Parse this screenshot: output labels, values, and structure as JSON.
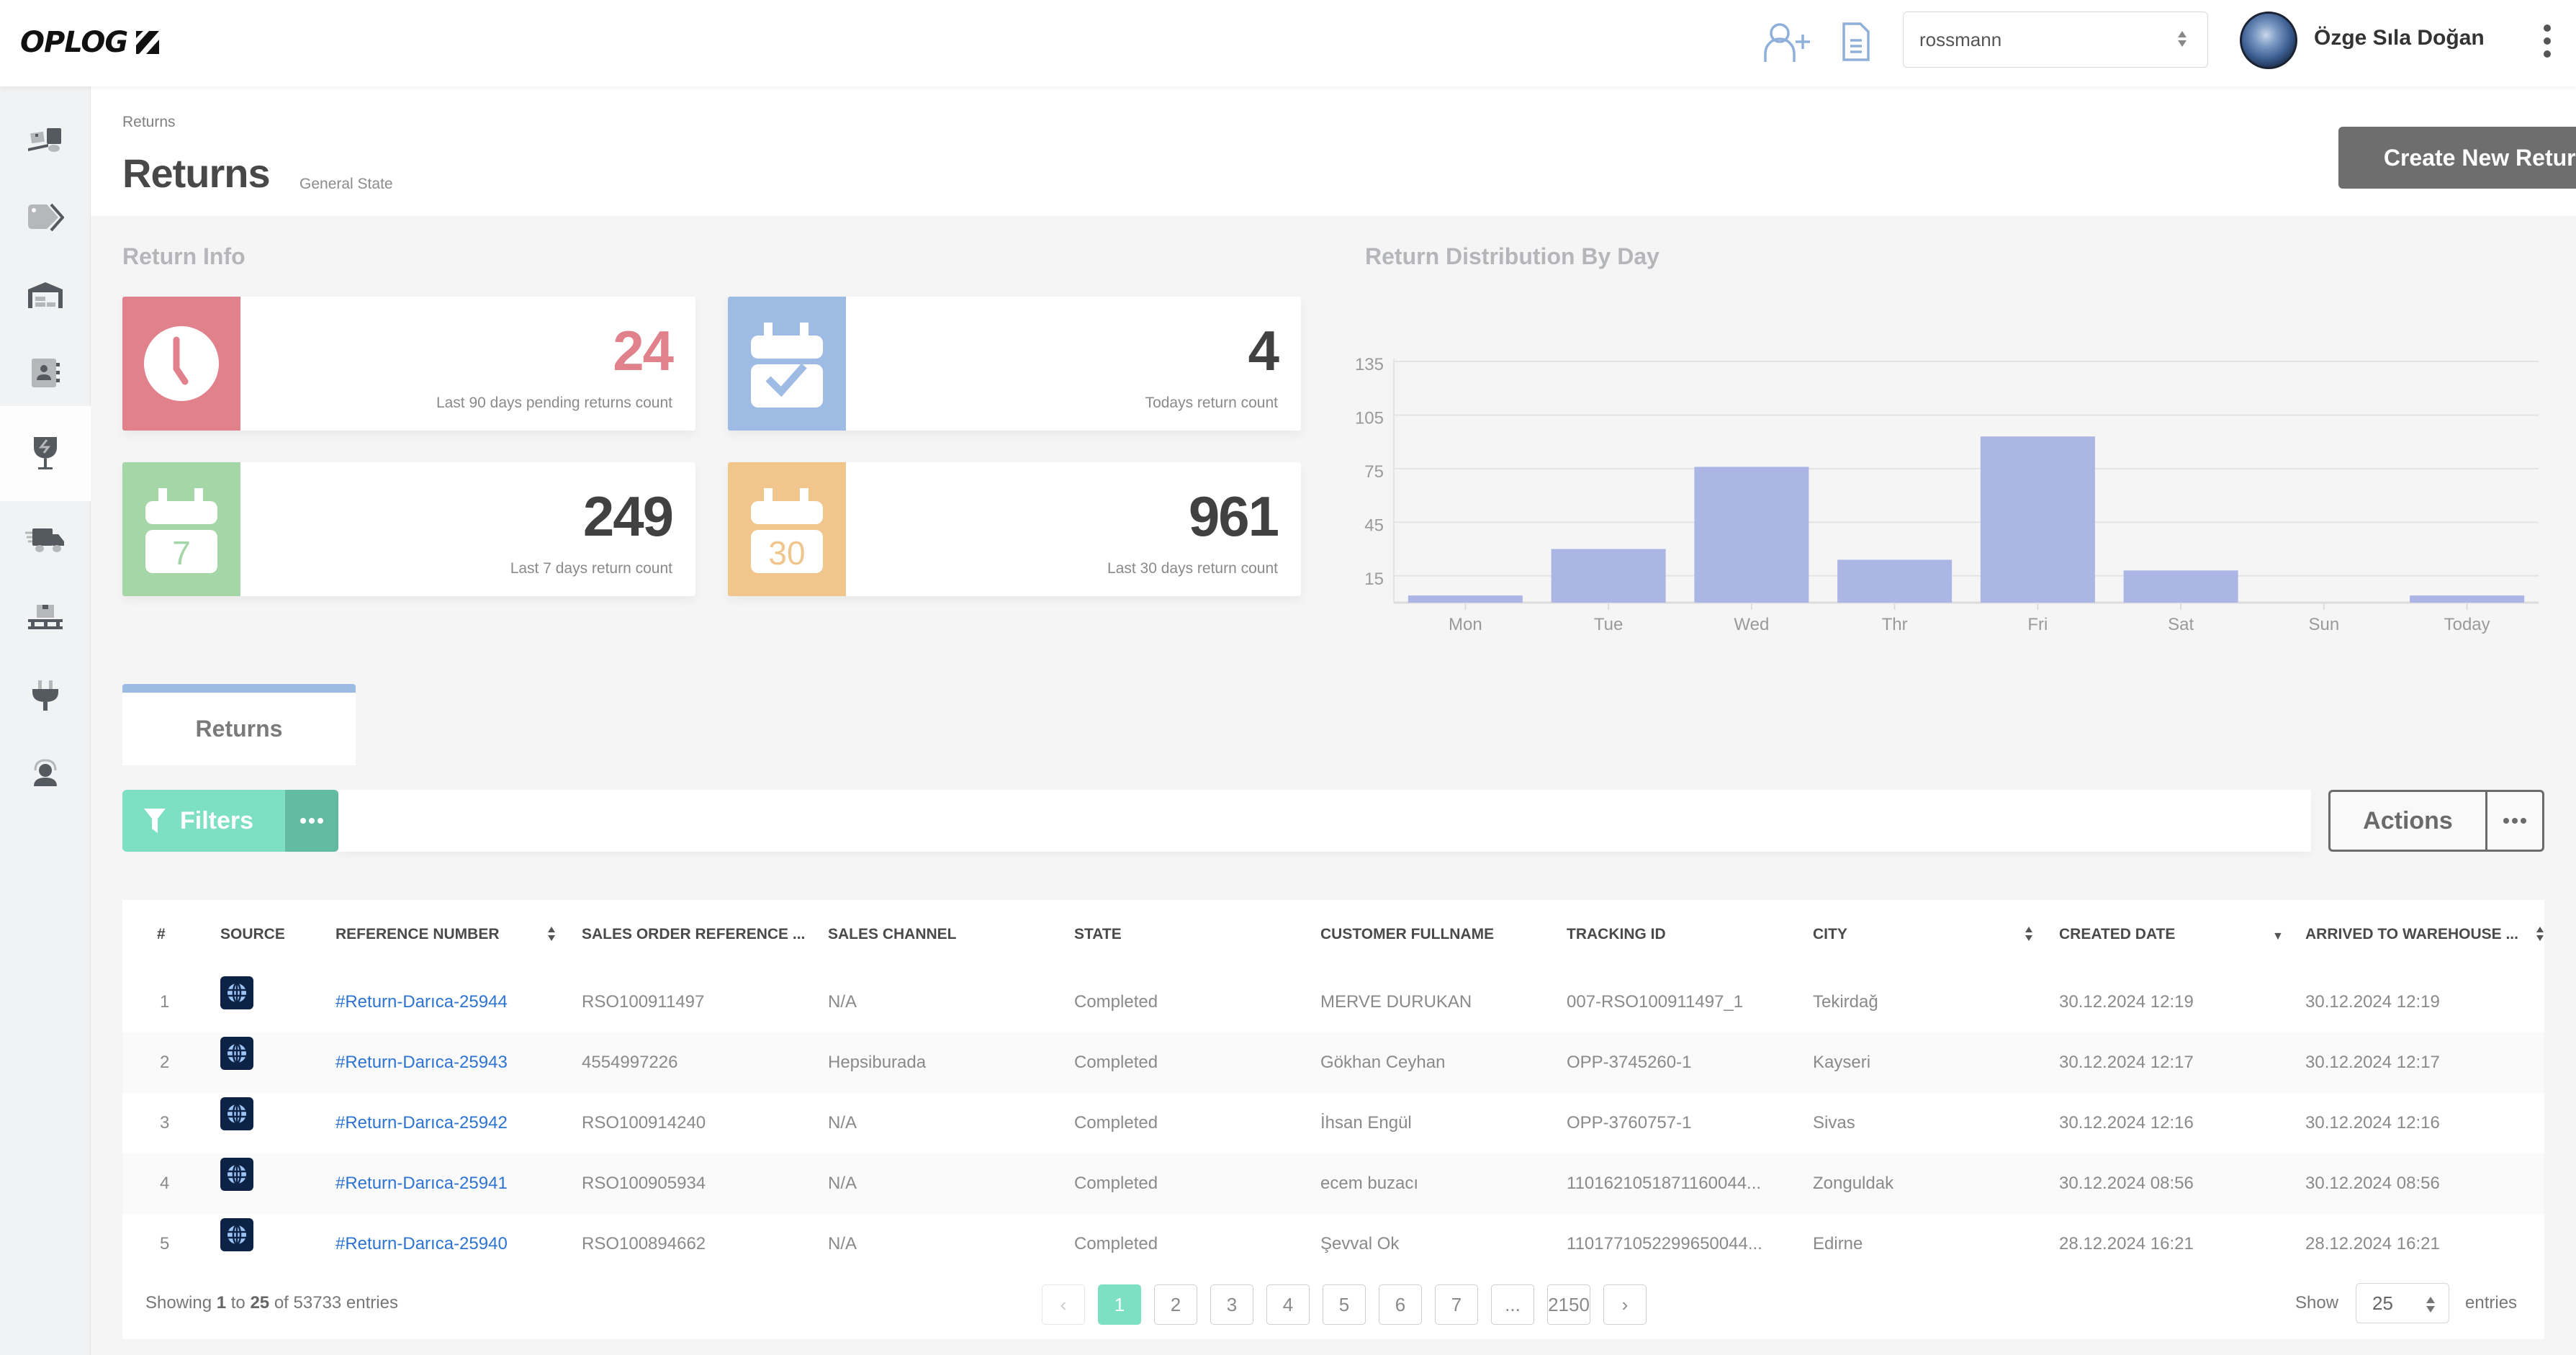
{
  "app": {
    "logo_text": "OPLOG",
    "company_select": {
      "value": "rossmann"
    },
    "user": {
      "name": "Özge Sıla Doğan"
    },
    "top_icons": [
      "add-user-icon",
      "document-icon"
    ]
  },
  "sidebar": {
    "items": [
      {
        "icon": "forklift-icon",
        "label": "Receiving",
        "active": false
      },
      {
        "icon": "tag-icon",
        "label": "Products",
        "active": false
      },
      {
        "icon": "warehouse-icon",
        "label": "Warehouse",
        "active": false
      },
      {
        "icon": "contacts-icon",
        "label": "Customers",
        "active": false
      },
      {
        "icon": "fragile-icon",
        "label": "Returns",
        "active": true
      },
      {
        "icon": "delivery-truck-icon",
        "label": "Shipments",
        "active": false
      },
      {
        "icon": "pallet-icon",
        "label": "Inventory",
        "active": false
      },
      {
        "icon": "plug-icon",
        "label": "Integrations",
        "active": false
      },
      {
        "icon": "support-agent-icon",
        "label": "Support",
        "active": false
      }
    ]
  },
  "header": {
    "breadcrumb": "Returns",
    "title": "Returns",
    "subtitle": "General State",
    "create_button": "Create New Return"
  },
  "return_info": {
    "title": "Return Info",
    "cards": [
      {
        "value": "24",
        "label": "Last 90 days pending returns count",
        "icon": "clock-icon",
        "color": "#e0818c",
        "value_color": "#e0818c"
      },
      {
        "value": "4",
        "label": "Todays return count",
        "icon": "calendar-check-icon",
        "color": "#9dbbe3",
        "value_color": "#414141"
      },
      {
        "value": "249",
        "label": "Last 7 days return count",
        "icon": "calendar-7-icon",
        "icon_text": "7",
        "color": "#a5d6a7",
        "value_color": "#414141"
      },
      {
        "value": "961",
        "label": "Last 30 days return count",
        "icon": "calendar-30-icon",
        "icon_text": "30",
        "color": "#f0c68c",
        "value_color": "#414141"
      }
    ]
  },
  "chart_data": {
    "type": "bar",
    "title": "Return Distribution By Day",
    "categories": [
      "Mon",
      "Tue",
      "Wed",
      "Thr",
      "Fri",
      "Sat",
      "Sun",
      "Today"
    ],
    "values": [
      4,
      30,
      76,
      24,
      93,
      18,
      0,
      4
    ],
    "xlabel": "",
    "ylabel": "",
    "ylim": [
      0,
      135
    ],
    "yticks": [
      15,
      45,
      75,
      105,
      135
    ],
    "grid": true,
    "legend": "none",
    "bar_color": "#abb6e5"
  },
  "tabs": [
    {
      "label": "Returns",
      "active": true
    }
  ],
  "toolbar": {
    "filters_label": "Filters",
    "actions_label": "Actions"
  },
  "table": {
    "columns": [
      {
        "label": "#",
        "sortable": false
      },
      {
        "label": "SOURCE",
        "sortable": false
      },
      {
        "label": "REFERENCE NUMBER",
        "sortable": true,
        "sort": "both"
      },
      {
        "label": "SALES ORDER REFERENCE ...",
        "sortable": false
      },
      {
        "label": "SALES CHANNEL",
        "sortable": false
      },
      {
        "label": "STATE",
        "sortable": false
      },
      {
        "label": "CUSTOMER FULLNAME",
        "sortable": false
      },
      {
        "label": "TRACKING ID",
        "sortable": false
      },
      {
        "label": "CITY",
        "sortable": true,
        "sort": "both"
      },
      {
        "label": "CREATED DATE",
        "sortable": true,
        "sort": "desc"
      },
      {
        "label": "ARRIVED TO WAREHOUSE ...",
        "sortable": true,
        "sort": "both"
      }
    ],
    "rows": [
      {
        "index": "1",
        "source": "web-globe-icon",
        "reference": "#Return-Darıca-25944",
        "sales_order_ref": "RSO100911497",
        "sales_channel": "N/A",
        "state": "Completed",
        "customer": "MERVE DURUKAN",
        "tracking_id": "007-RSO100911497_1",
        "city": "Tekirdağ",
        "created": "30.12.2024 12:19",
        "arrived": "30.12.2024 12:19"
      },
      {
        "index": "2",
        "source": "web-globe-icon",
        "reference": "#Return-Darıca-25943",
        "sales_order_ref": "4554997226",
        "sales_channel": "Hepsiburada",
        "state": "Completed",
        "customer": "Gökhan Ceyhan",
        "tracking_id": "OPP-3745260-1",
        "city": "Kayseri",
        "created": "30.12.2024 12:17",
        "arrived": "30.12.2024 12:17"
      },
      {
        "index": "3",
        "source": "web-globe-icon",
        "reference": "#Return-Darıca-25942",
        "sales_order_ref": "RSO100914240",
        "sales_channel": "N/A",
        "state": "Completed",
        "customer": "İhsan Engül",
        "tracking_id": "OPP-3760757-1",
        "city": "Sivas",
        "created": "30.12.2024 12:16",
        "arrived": "30.12.2024 12:16"
      },
      {
        "index": "4",
        "source": "web-globe-icon",
        "reference": "#Return-Darıca-25941",
        "sales_order_ref": "RSO100905934",
        "sales_channel": "N/A",
        "state": "Completed",
        "customer": "ecem buzacı",
        "tracking_id": "1101621051871160044...",
        "city": "Zonguldak",
        "created": "30.12.2024 08:56",
        "arrived": "30.12.2024 08:56"
      },
      {
        "index": "5",
        "source": "web-globe-icon",
        "reference": "#Return-Darıca-25940",
        "sales_order_ref": "RSO100894662",
        "sales_channel": "N/A",
        "state": "Completed",
        "customer": "Şevval Ok",
        "tracking_id": "1101771052299650044...",
        "city": "Edirne",
        "created": "28.12.2024 16:21",
        "arrived": "28.12.2024 16:21"
      }
    ]
  },
  "footer": {
    "showing_prefix": "Showing",
    "showing_from": "1",
    "showing_to_word": "to",
    "showing_to": "25",
    "showing_of": "of 53733 entries",
    "pages": [
      "‹",
      "1",
      "2",
      "3",
      "4",
      "5",
      "6",
      "7",
      "...",
      "2150",
      "›"
    ],
    "current_page": "1",
    "show_label": "Show",
    "page_size": "25",
    "entries_label": "entries"
  }
}
